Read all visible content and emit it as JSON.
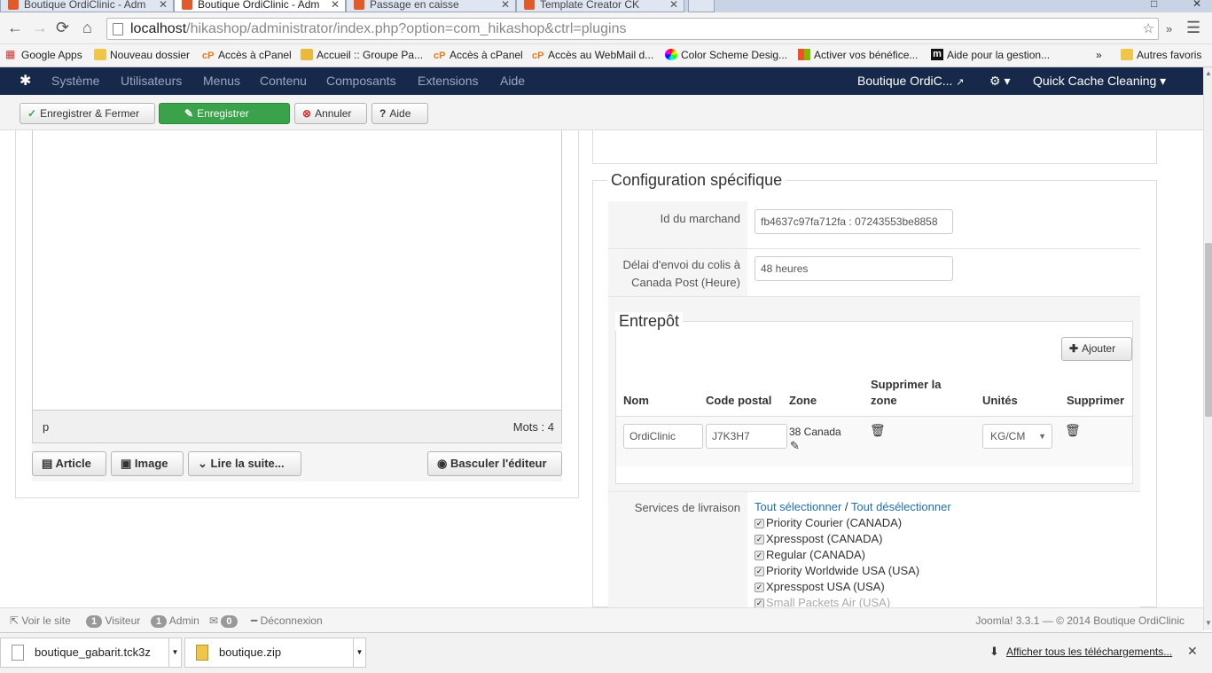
{
  "browser": {
    "tabs": [
      {
        "title": "Boutique OrdiClinic - Adm",
        "active": false
      },
      {
        "title": "Boutique OrdiClinic - Adm",
        "active": true
      },
      {
        "title": "Passage en caisse",
        "active": false
      },
      {
        "title": "Template Creator CK",
        "active": false
      }
    ],
    "url_host": "localhost",
    "url_path": "/hikashop/administrator/index.php?option=com_hikashop&ctrl=plugins",
    "bookmarks": [
      {
        "label": "Google Apps",
        "icon": "apps-grid-icon"
      },
      {
        "label": "Nouveau dossier",
        "icon": "folder-icon"
      },
      {
        "label": "Accès à cPanel",
        "icon": "cpanel-icon"
      },
      {
        "label": "Accueil :: Groupe Pa...",
        "icon": "mail-icon"
      },
      {
        "label": "Accès à cPanel",
        "icon": "cpanel-icon"
      },
      {
        "label": "Accès au WebMail d...",
        "icon": "cpanel-icon"
      },
      {
        "label": "Color Scheme Desig...",
        "icon": "color-wheel-icon"
      },
      {
        "label": "Activer vos bénéfice...",
        "icon": "windows-icon"
      },
      {
        "label": "Aide pour la gestion...",
        "icon": "m-logo-icon"
      }
    ],
    "bookmarks_more": "»",
    "other_bookmarks": "Autres favoris"
  },
  "admin_nav": {
    "menu": [
      "Système",
      "Utilisateurs",
      "Menus",
      "Contenu",
      "Composants",
      "Extensions",
      "Aide"
    ],
    "site_name": "Boutique OrdiC...",
    "quick_cache": "Quick Cache Cleaning"
  },
  "toolbar": {
    "save_close": "Enregistrer & Fermer",
    "save": "Enregistrer",
    "cancel": "Annuler",
    "help": "Aide"
  },
  "editor": {
    "path": "p",
    "word_count": "Mots : 4",
    "buttons": {
      "article": "Article",
      "image": "Image",
      "readmore": "Lire la suite...",
      "toggle": "Basculer l'éditeur"
    }
  },
  "config": {
    "legend": "Configuration spécifique",
    "merchant_label": "Id du marchand",
    "merchant_value": "fb4637c97fa712fa : 07243553be8858",
    "delay_label": "Délai d'envoi du colis à Canada Post (Heure)",
    "delay_value": "48 heures",
    "warehouse": {
      "legend": "Entrepôt",
      "add_button": "Ajouter",
      "headers": {
        "name": "Nom",
        "postal": "Code postal",
        "zone": "Zone",
        "delete_zone": "Supprimer la zone",
        "units": "Unités",
        "delete": "Supprimer"
      },
      "row": {
        "name": "OrdiClinic",
        "postal": "J7K3H7",
        "zone": "38 Canada",
        "units": "KG/CM"
      }
    },
    "services_label": "Services de livraison",
    "select_all": "Tout sélectionner",
    "separator": "/",
    "deselect_all": "Tout désélectionner",
    "services": [
      "Priority Courier (CANADA)",
      "Xpresspost (CANADA)",
      "Regular (CANADA)",
      "Priority Worldwide USA (USA)",
      "Xpresspost USA (USA)",
      "Small Packets Air (USA)"
    ]
  },
  "status": {
    "view_site": "Voir le site",
    "visitors_count": "1",
    "visitors_label": "Visiteur",
    "admin_count": "1",
    "admin_label": "Admin",
    "msg_count": "0",
    "logout": "Déconnexion",
    "version": "Joomla! 3.3.1 — © 2014 Boutique OrdiClinic"
  },
  "downloads": {
    "items": [
      "boutique_gabarit.tck3z",
      "boutique.zip"
    ],
    "show_all": "Afficher tous les téléchargements..."
  }
}
